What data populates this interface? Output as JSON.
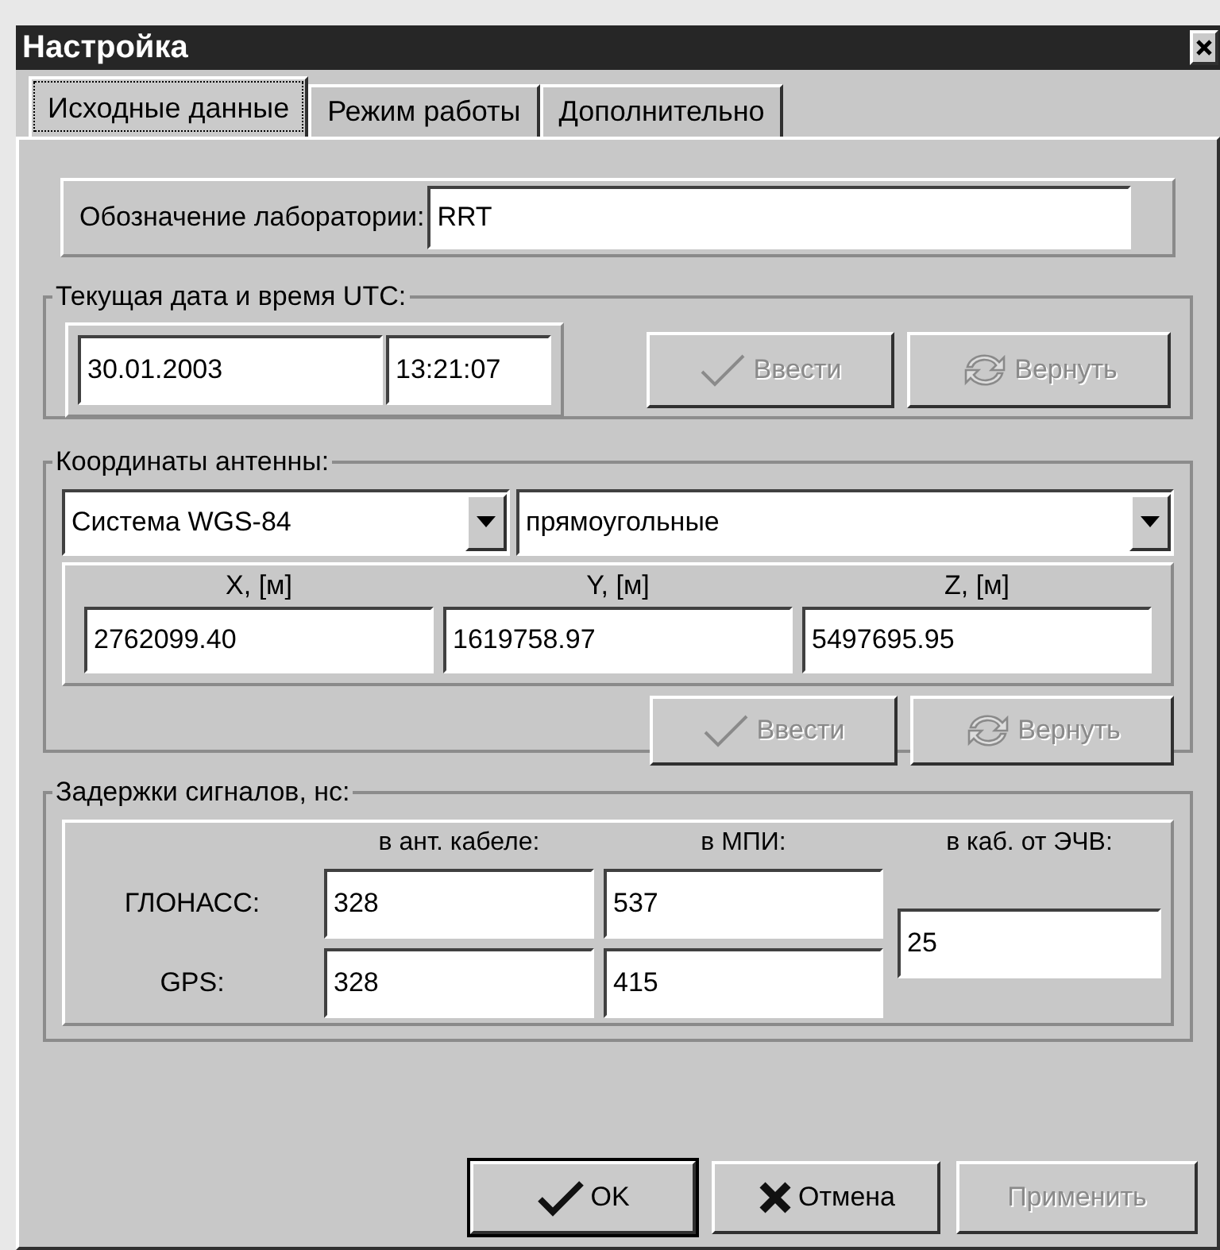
{
  "window": {
    "title": "Настройка"
  },
  "tabs": [
    {
      "label": "Исходные данные",
      "selected": true
    },
    {
      "label": "Режим работы",
      "selected": false
    },
    {
      "label": "Дополнительно",
      "selected": false
    }
  ],
  "laboratory": {
    "label": "Обозначение лаборатории:",
    "value": "RRT"
  },
  "datetime_group": {
    "title": "Текущая дата и время UTC:",
    "date": "30.01.2003",
    "time": "13:21:07",
    "buttons": [
      {
        "kind": "apply",
        "label": "Ввести",
        "disabled": true
      },
      {
        "kind": "revert",
        "label": "Вернуть",
        "disabled": true
      }
    ]
  },
  "coordinates_group": {
    "title": "Координаты антенны:",
    "system": "Система WGS-84",
    "coordinate_type": "прямоугольные",
    "columns": [
      "X, [м]",
      "Y, [м]",
      "Z, [м]"
    ],
    "values": [
      "2762099.40",
      "1619758.97",
      "5497695.95"
    ],
    "buttons": [
      {
        "kind": "apply",
        "label": "Ввести",
        "disabled": true
      },
      {
        "kind": "revert",
        "label": "Вернуть",
        "disabled": true
      }
    ]
  },
  "delays_group": {
    "title": "Задержки сигналов, нс:",
    "columns": [
      "в ант. кабеле:",
      "в МПИ:",
      "в каб. от ЭЧВ:"
    ],
    "rows": [
      {
        "label": "ГЛОНАСС:",
        "values": [
          "328",
          "537"
        ]
      },
      {
        "label": "GPS:",
        "values": [
          "328",
          "415"
        ]
      }
    ],
    "cable_value": "25"
  },
  "buttons": [
    {
      "kind": "ok",
      "label": "OK",
      "disabled": false
    },
    {
      "kind": "cancel",
      "label": "Отмена",
      "disabled": false
    },
    {
      "kind": "plain",
      "label": "Применить",
      "disabled": true
    }
  ]
}
